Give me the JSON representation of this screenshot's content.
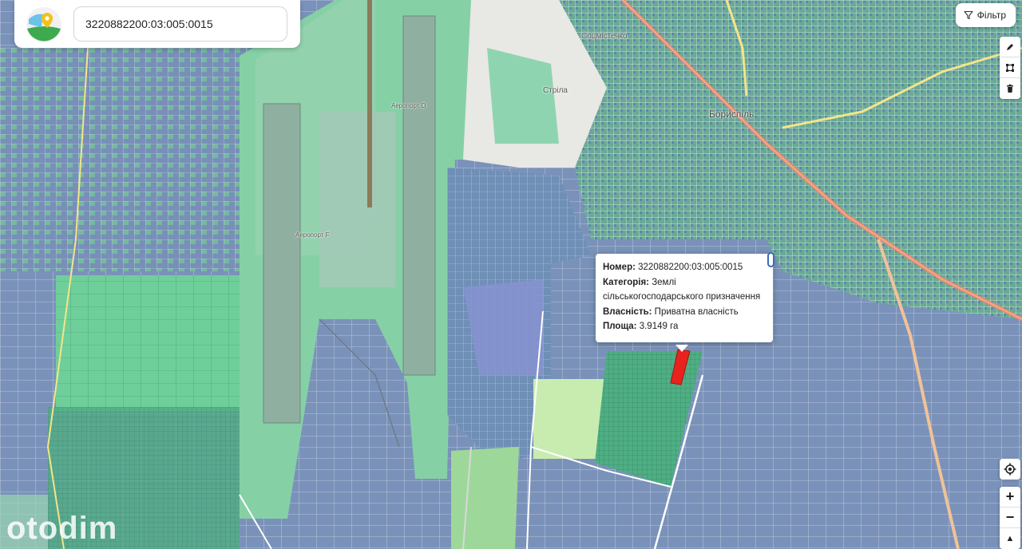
{
  "search": {
    "value": "3220882200:03:005:0015"
  },
  "filter": {
    "label": "Фільтр"
  },
  "tools": {
    "draw": "pencil-icon",
    "polygon": "polygon-icon",
    "delete": "trash-icon",
    "locate": "locate-icon",
    "zoom_in": "+",
    "zoom_out": "−",
    "compass": "▲"
  },
  "popup": {
    "number_label": "Номер:",
    "number_value": " 3220882200:03:005:0015",
    "category_label": "Категорія:",
    "category_value": " Землі сільськогосподарського призначення",
    "ownership_label": "Власність:",
    "ownership_value": " Приватна власність",
    "area_label": "Площа:",
    "area_value": " 3.9149 га"
  },
  "map_labels": {
    "town": "Бориспіль",
    "sotsmistechko": "Соцмістечко",
    "strila": "Стріла",
    "terminal_d": "Аеропорт D",
    "terminal_f": "Аеропорт F"
  },
  "watermark": "otodim",
  "colors": {
    "parcel_blue": "#7d93b8",
    "parcel_green": "#5fbf8f",
    "selected_parcel": "#e8231e",
    "road": "#e8876b",
    "accent": "#3b6fb6"
  }
}
